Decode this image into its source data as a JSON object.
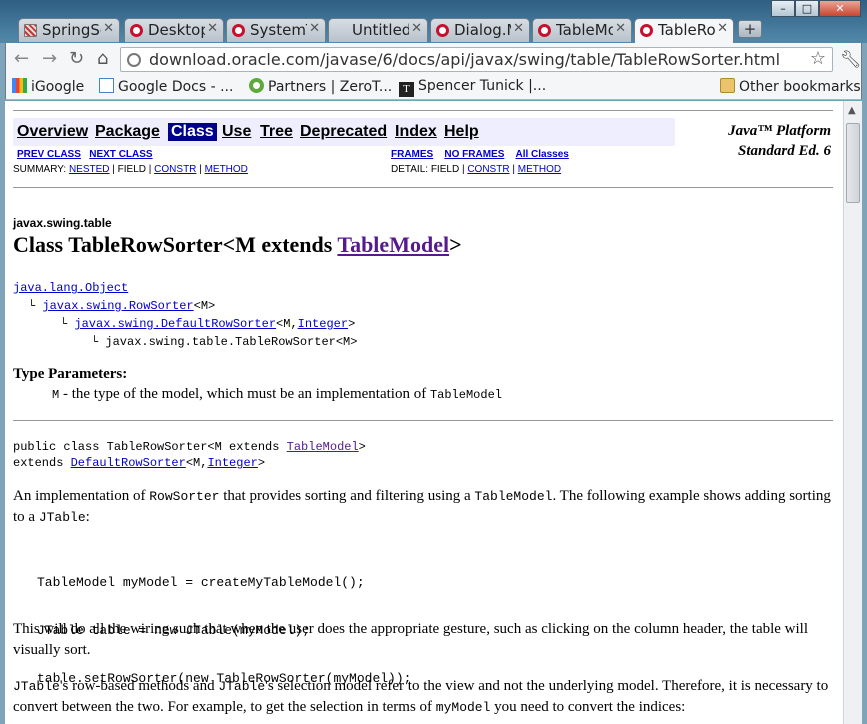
{
  "tabs": [
    {
      "label": "SpringSo",
      "icon": "spring-icon",
      "active": false
    },
    {
      "label": "Desktop",
      "icon": "oracle-icon",
      "active": false
    },
    {
      "label": "SystemT",
      "icon": "oracle-icon",
      "active": false
    },
    {
      "label": "Untitled",
      "icon": "blank-icon",
      "active": false
    },
    {
      "label": "Dialog.M",
      "icon": "oracle-icon",
      "active": false
    },
    {
      "label": "TableMo",
      "icon": "oracle-icon",
      "active": false
    },
    {
      "label": "TableRo",
      "icon": "oracle-icon",
      "active": true
    }
  ],
  "new_tab_label": "+",
  "window_controls": {
    "minimize": "–",
    "maximize": "□",
    "close": "✕"
  },
  "address_bar": {
    "url": "download.oracle.com/javase/6/docs/api/javax/swing/table/TableRowSorter.html"
  },
  "bookmarks": [
    {
      "label": "iGoogle",
      "icon": "google-icon"
    },
    {
      "label": "Google Docs - ...",
      "icon": "docs-icon"
    },
    {
      "label": "Partners | ZeroT...",
      "icon": "partners-icon"
    },
    {
      "label": "Spencer Tunick |...",
      "icon": "nyt-icon"
    }
  ],
  "other_bookmarks": "Other bookmarks",
  "page": {
    "nav": {
      "overview": "Overview",
      "package": "Package",
      "class": "Class",
      "use": "Use",
      "tree": "Tree",
      "deprecated": "Deprecated",
      "index": "Index",
      "help": "Help"
    },
    "platform_line1": "Java™ Platform",
    "platform_line2": "Standard Ed. 6",
    "prev_class": "PREV CLASS",
    "next_class": "NEXT CLASS",
    "frames": "FRAMES",
    "no_frames": "NO FRAMES",
    "all_classes": "All Classes",
    "summary_label": "SUMMARY:",
    "summary_nested": "NESTED",
    "summary_field": "| FIELD |",
    "summary_constr": "CONSTR",
    "summary_sep": "|",
    "summary_method": "METHOD",
    "detail_label": "DETAIL: FIELD |",
    "detail_constr": "CONSTR",
    "detail_sep": "|",
    "detail_method": "METHOD",
    "package_name": "javax.swing.table",
    "class_title_prefix": "Class TableRowSorter<M extends ",
    "class_title_link": "TableModel",
    "class_title_suffix": ">",
    "hierarchy": {
      "object": "java.lang.Object",
      "rowsorter": "javax.swing.RowSorter",
      "rowsorter_generic": "<M>",
      "defaultrowsorter": "javax.swing.DefaultRowSorter",
      "defaultrowsorter_generic_a": "<M,",
      "integer": "Integer",
      "defaultrowsorter_generic_b": ">",
      "this_class": "javax.swing.table.TableRowSorter<M>"
    },
    "type_params_heading": "Type Parameters:",
    "type_param_name": "M",
    "type_param_desc": " - the type of the model, which must be an implementation of ",
    "type_param_code": "TableModel",
    "decl_line1_prefix": "public class TableRowSorter<M extends ",
    "decl_line1_link": "TableModel",
    "decl_line1_suffix": ">",
    "decl_line2_prefix": "extends ",
    "decl_line2_link1": "DefaultRowSorter",
    "decl_line2_mid": "<M,",
    "decl_line2_link2": "Integer",
    "decl_line2_suffix": ">",
    "desc1_a": "An implementation of ",
    "desc1_code1": "RowSorter",
    "desc1_b": " that provides sorting and filtering using a ",
    "desc1_code2": "TableModel",
    "desc1_c": ". The following example shows adding sorting to a ",
    "desc1_code3": "JTable",
    "desc1_d": ":",
    "code_lines": [
      "TableModel myModel = createMyTableModel();",
      "JTable table = new JTable(myModel);",
      "table.setRowSorter(new TableRowSorter(myModel));"
    ],
    "desc2": "This will do all the wiring such that when the user does the appropriate gesture, such as clicking on the column header, the table will visually sort.",
    "desc3_code1": "JTable",
    "desc3_a": "'s row-based methods and ",
    "desc3_code2": "JTable",
    "desc3_b": "'s selection model refer to the view and not the underlying model. Therefore, it is necessary to convert between the two. For example, to get the selection in terms of ",
    "desc3_code3": "myModel",
    "desc3_c": " you need to convert the indices:"
  },
  "colors": {
    "link": "#0000cc",
    "visited_link": "#551a8b",
    "nav_bg": "#eeeeff",
    "nav_current_bg": "#00008b"
  }
}
